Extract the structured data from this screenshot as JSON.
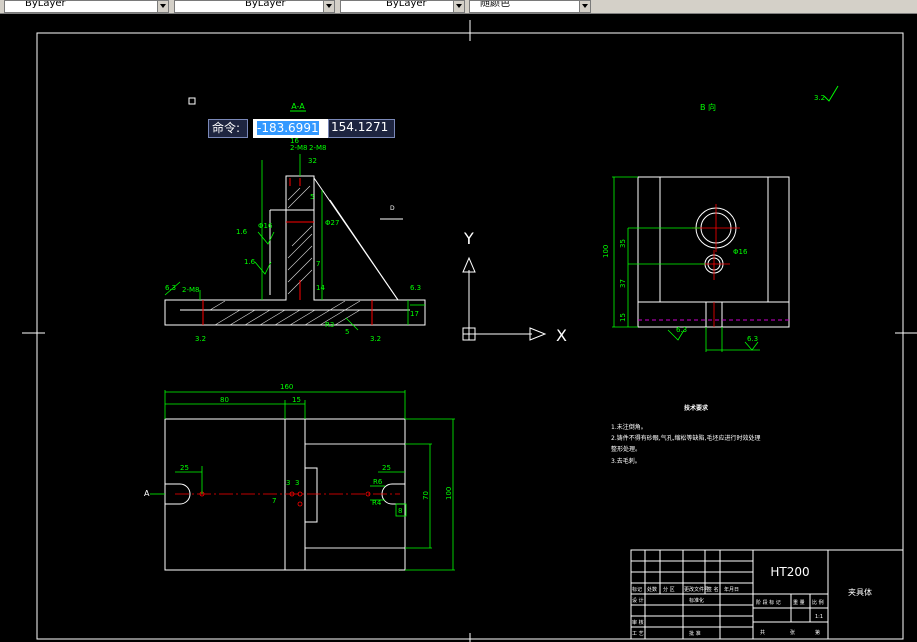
{
  "toolbar": {
    "linetype": "ByLayer",
    "lineweight": "ByLayer",
    "plotstyle": "ByLayer",
    "color": "随颜色"
  },
  "command": {
    "label": "命令:",
    "x_value": "-183.6991",
    "y_value": "154.1271"
  },
  "ucs": {
    "y_label": "Y",
    "x_label": "X"
  },
  "views": {
    "section_title": "A-A",
    "side_title": "B 向",
    "roughness_symbol": "3.2"
  },
  "dims_front": {
    "d16": "16",
    "d32": "32",
    "r_left": "6.3",
    "r_right": "6.3",
    "r_bl": "3.2",
    "r_br": "3.2",
    "r_mid1": "1.6",
    "r_mid2": "1.6",
    "r_top": "1.6",
    "r3": "R3",
    "d17": "17",
    "d5": "5",
    "phi27": "Φ27",
    "phi16": "Φ16",
    "m8": "2-M8",
    "d7": "7",
    "d14": "14"
  },
  "dims_side": {
    "d100": "100",
    "d35": "35",
    "d37": "37",
    "d15": "15",
    "phi16": "Φ16",
    "r63": "6.3",
    "r63b": "6.3"
  },
  "dims_top": {
    "overall": "160",
    "d80": "80",
    "d15": "15",
    "d25a": "25",
    "d25b": "25",
    "r6": "R6",
    "r4": "R4",
    "d8": "8",
    "d70": "70",
    "d100": "100",
    "d3a": "3",
    "d3b": "3",
    "d7": "7",
    "a_label": "A"
  },
  "notes": {
    "title": "技术要求",
    "line1": "1.未注倒角。",
    "line2": "2.铸件不得有砂眼,气孔,缩松等缺陷,毛坯应进行时效处理",
    "line3": "整形处理。",
    "line4": "3.去毛刺。"
  },
  "title_block": {
    "material": "HT200",
    "part_name": "夹具体",
    "c_biaoji": "标记",
    "c_chushu": "处数",
    "c_fenqu": "分 区",
    "c_gaiwenjian": "更改文件号",
    "c_qianming": "签 名",
    "c_riqi": "年月日",
    "c_sheji": "设 计",
    "c_biaozhunhua": "标准化",
    "c_shenhe": "审 核",
    "c_gongyi": "工 艺",
    "c_pizhun": "批 准",
    "c_jieduan": "阶 段 标 记",
    "c_zhongliang": "重 量",
    "c_bili": "比 例",
    "c_ratio": "1:1",
    "c_gong": "共",
    "c_zhang": "张",
    "c_di": "第"
  }
}
